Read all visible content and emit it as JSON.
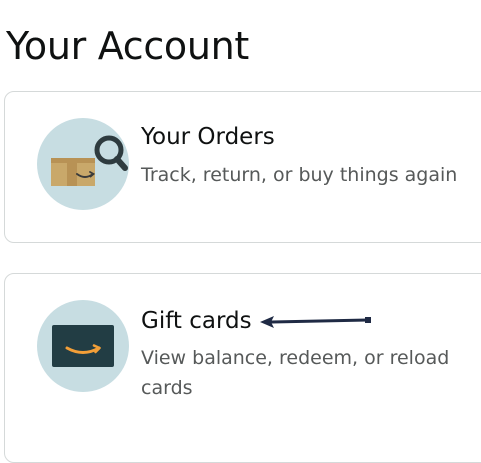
{
  "page": {
    "title": "Your Account"
  },
  "cards": [
    {
      "title": "Your Orders",
      "description": "Track, return, or buy things again",
      "icon": "orders-package-search-icon"
    },
    {
      "title": "Gift cards",
      "description": "View balance, redeem, or reload cards",
      "icon": "gift-card-icon"
    }
  ],
  "colors": {
    "icon_background": "#c7dde2",
    "package": "#c9a86a",
    "gift_card": "#223d44",
    "smile": "#f29f38",
    "arrow": "#1f2a44"
  }
}
